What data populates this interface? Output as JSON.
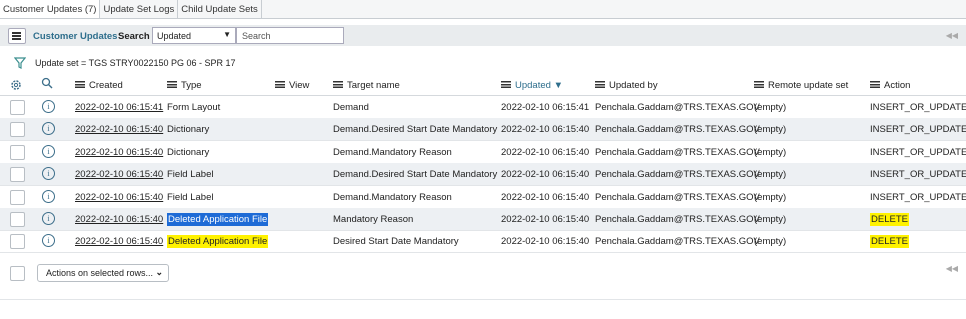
{
  "tabs": [
    {
      "label": "Customer Updates (7)",
      "active": true
    },
    {
      "label": "Update Set Logs",
      "active": false
    },
    {
      "label": "Child Update Sets",
      "active": false
    }
  ],
  "toolbar": {
    "title": "Customer Updates",
    "search_label": "Search",
    "search_field": "Updated",
    "search_placeholder": "Search",
    "pager_icon": "first-page-icon",
    "pager_glyph": "◀◀"
  },
  "filter": {
    "text": "Update set = TGS STRY0022150 PG 06 - SPR 17"
  },
  "columns": {
    "created": "Created",
    "type": "Type",
    "view": "View",
    "target_name": "Target name",
    "updated": "Updated",
    "updated_by": "Updated by",
    "remote_update_set": "Remote update set",
    "action": "Action",
    "sort_glyph": "▼"
  },
  "rows": [
    {
      "created": "2022-02-10 06:15:41",
      "type": "Form Layout",
      "view": "",
      "target_name": "Demand",
      "updated": "2022-02-10 06:15:41",
      "updated_by": "Penchala.Gaddam@TRS.TEXAS.GOV",
      "remote_update_set": "(empty)",
      "action": "INSERT_OR_UPDATE"
    },
    {
      "created": "2022-02-10 06:15:40",
      "type": "Dictionary",
      "view": "",
      "target_name": "Demand.Desired Start Date Mandatory",
      "updated": "2022-02-10 06:15:40",
      "updated_by": "Penchala.Gaddam@TRS.TEXAS.GOV",
      "remote_update_set": "(empty)",
      "action": "INSERT_OR_UPDATE"
    },
    {
      "created": "2022-02-10 06:15:40",
      "type": "Dictionary",
      "view": "",
      "target_name": "Demand.Mandatory Reason",
      "updated": "2022-02-10 06:15:40",
      "updated_by": "Penchala.Gaddam@TRS.TEXAS.GOV",
      "remote_update_set": "(empty)",
      "action": "INSERT_OR_UPDATE"
    },
    {
      "created": "2022-02-10 06:15:40",
      "type": "Field Label",
      "view": "",
      "target_name": "Demand.Desired Start Date Mandatory",
      "updated": "2022-02-10 06:15:40",
      "updated_by": "Penchala.Gaddam@TRS.TEXAS.GOV",
      "remote_update_set": "(empty)",
      "action": "INSERT_OR_UPDATE"
    },
    {
      "created": "2022-02-10 06:15:40",
      "type": "Field Label",
      "view": "",
      "target_name": "Demand.Mandatory Reason",
      "updated": "2022-02-10 06:15:40",
      "updated_by": "Penchala.Gaddam@TRS.TEXAS.GOV",
      "remote_update_set": "(empty)",
      "action": "INSERT_OR_UPDATE"
    },
    {
      "created": "2022-02-10 06:15:40",
      "type": "Deleted Application File",
      "view": "",
      "target_name": "Mandatory Reason",
      "updated": "2022-02-10 06:15:40",
      "updated_by": "Penchala.Gaddam@TRS.TEXAS.GOV",
      "remote_update_set": "(empty)",
      "action": "DELETE"
    },
    {
      "created": "2022-02-10 06:15:40",
      "type": "Deleted Application File",
      "view": "",
      "target_name": "Desired Start Date Mandatory",
      "updated": "2022-02-10 06:15:40",
      "updated_by": "Penchala.Gaddam@TRS.TEXAS.GOV",
      "remote_update_set": "(empty)",
      "action": "DELETE"
    }
  ],
  "bottom": {
    "actions_label": "Actions on selected rows...",
    "pager_icon": "first-page-icon",
    "pager_glyph": "◀◀"
  },
  "colors": {
    "accent": "#2e6e8c",
    "highlight": "#fff200",
    "selection": "#1e6bd6",
    "alt_row": "#edf0f3"
  }
}
